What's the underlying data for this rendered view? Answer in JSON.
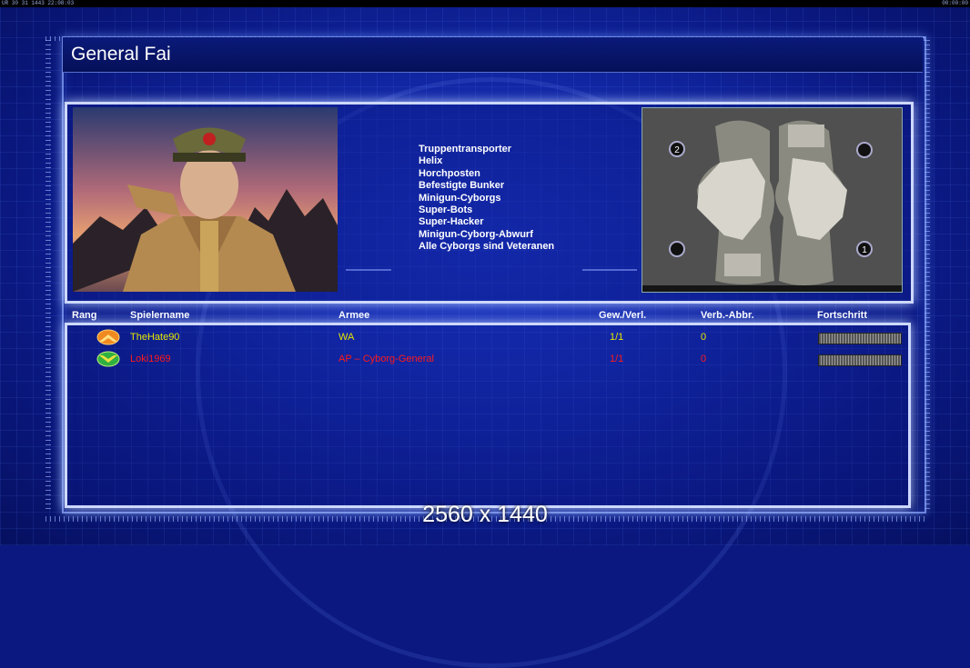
{
  "status_bar": {
    "left_text": "UR 30 31 1443 22:08:03",
    "right_text": "00:00:00"
  },
  "screen": {
    "title": "General Fai",
    "features": [
      "Truppentransporter",
      "Helix",
      "Horchposten",
      "Befestigte Bunker",
      "Minigun-Cyborgs",
      "Super-Bots",
      "Super-Hacker",
      "Minigun-Cyborg-Abwurf",
      "Alle Cyborgs sind Veteranen"
    ],
    "map": {
      "start_positions": [
        "2",
        "",
        "",
        "1"
      ]
    }
  },
  "table": {
    "columns": {
      "rank": "Rang",
      "player": "Spielername",
      "army": "Armee",
      "winloss": "Gew./Verl.",
      "disconnects": "Verb.-Abbr.",
      "progress": "Fortschritt"
    },
    "rows": [
      {
        "rank_icon": "rank-chevron-orange-icon",
        "player": "TheHate90",
        "army": "WA",
        "winloss": "1/1",
        "disconnects": "0",
        "color": "#e8e800",
        "progress": 1.0
      },
      {
        "rank_icon": "rank-chevron-green-icon",
        "player": "Loki1969",
        "army": "AP – Cyborg-General",
        "winloss": "1/1",
        "disconnects": "0",
        "color": "#ff1a1a",
        "progress": 1.0
      }
    ]
  },
  "overlay": {
    "resolution": "2560 x 1440"
  }
}
